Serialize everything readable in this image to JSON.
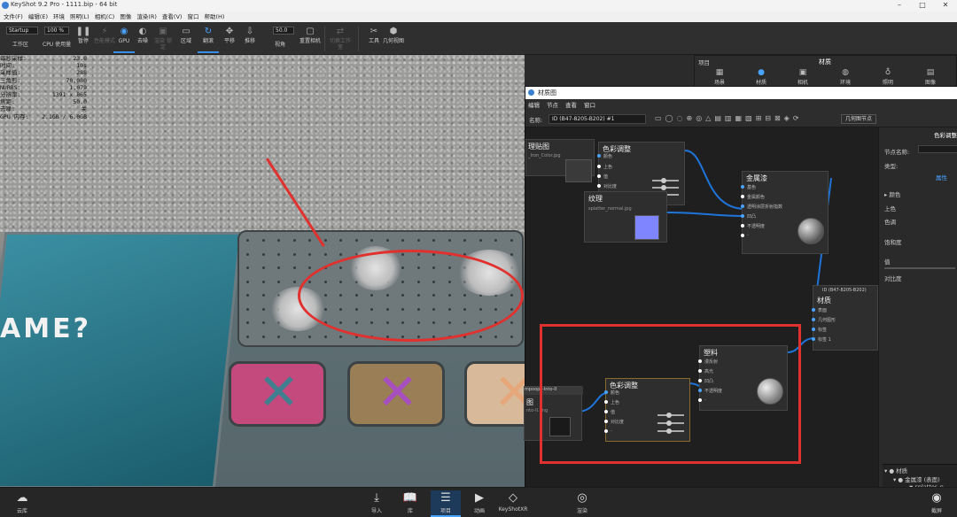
{
  "titlebar": {
    "title": "KeyShot 9.2 Pro  - 1111.bip  - 64 bit",
    "minimize": "–",
    "maximize": "□",
    "close": "✕"
  },
  "menubar": [
    "文件(F)",
    "编辑(E)",
    "环境",
    "照明(L)",
    "相机(C)",
    "图像",
    "渲染(R)",
    "查看(V)",
    "窗口",
    "帮助(H)"
  ],
  "toolbar": {
    "workspace_value": "Startup",
    "workspace_label": "工作区",
    "cpu_value": "100 %",
    "cpu_label": "CPU 使用量",
    "pause_label": "暂停",
    "perf_label": "性能模式",
    "gpu_label": "GPU",
    "denoise_label": "去噪",
    "lock_label": "渲染 锁定",
    "region_label": "区域",
    "tumble_label": "翻滚",
    "pan_label": "平移",
    "dolly_label": "推移",
    "fov_value": "50.0",
    "fov_label": "视角",
    "reset_label": "重置相机",
    "switch_label": "切换工作室",
    "tools_label": "工具",
    "geom_label": "几何视图"
  },
  "stats": [
    {
      "k": "每秒采样:",
      "v": "23.0"
    },
    {
      "k": "时间:",
      "v": "10s"
    },
    {
      "k": "采样值:",
      "v": "288"
    },
    {
      "k": "三角形:",
      "v": "70,080"
    },
    {
      "k": "NURBS:",
      "v": "1,079"
    },
    {
      "k": "分辨率:",
      "v": "1391 x 865"
    },
    {
      "k": "焦距:",
      "v": "50.0"
    },
    {
      "k": "去噪:",
      "v": "关"
    },
    {
      "k": "GPU 内存:",
      "v": "2.1GB / 6.0GB"
    }
  ],
  "scene": {
    "game_text": "AME?"
  },
  "bottombar": {
    "library": "云库",
    "import": "导入",
    "library2": "库",
    "project": "项目",
    "animation": "动画",
    "keyshotxr": "KeyShotXR",
    "render": "渲染",
    "screenshot": "截屏"
  },
  "rightpanel": {
    "header_left": "项目",
    "header_title": "材质",
    "tabs": [
      "场景",
      "材质",
      "相机",
      "环境",
      "照明",
      "图像"
    ]
  },
  "mat_window": {
    "title": "材质图",
    "menu": [
      "编辑",
      "节点",
      "查看",
      "窗口"
    ],
    "name_label": "名称:",
    "name_value": "ID (B47-8205-B202) #1",
    "geo_node_btn": "几何图节点",
    "props_title": "色彩调整",
    "props_node_name": "节点名称:",
    "props_type": "类型:",
    "props_tab": "属性",
    "props_fields": [
      "颜色",
      "上色",
      "色调",
      "饱和度",
      "值",
      "对比度"
    ],
    "tree": {
      "root": "材质",
      "child": "金属漆 (表面)",
      "leaf": "splatter_n"
    }
  },
  "graph": {
    "tex1": {
      "title": "理贴图",
      "file": "_Iron_Color.jpg"
    },
    "cc1": {
      "title": "色彩调整",
      "ports": [
        "颜色",
        "上色",
        "值",
        "对比度",
        "-"
      ]
    },
    "bump": {
      "title": "纹理",
      "file": "splatter_normal.jpg"
    },
    "metal": {
      "title": "金属漆",
      "ports": [
        "基色",
        "金属颜色",
        "透明涂层折射指数",
        "凹凸",
        "不透明度",
        "-"
      ]
    },
    "mat": {
      "title": "材质",
      "id": "ID (B47-8205-B202)",
      "ports": [
        "表面",
        "几何图形",
        "标签",
        "标签 1"
      ]
    },
    "tex2": {
      "title": "图",
      "file_top": "mpoops-Into-II",
      "file": "nto-II.png"
    },
    "cc2": {
      "title": "色彩调整",
      "ports": [
        "颜色",
        "上色",
        "值",
        "对比度",
        "-"
      ]
    },
    "plastic": {
      "title": "塑料",
      "ports": [
        "漫反射",
        "高光",
        "凹凸",
        "不透明度",
        "-"
      ]
    }
  },
  "colors": {
    "accent": "#4aa3ff",
    "annotation": "#e0312e",
    "tile_pink": "#c44a7e",
    "tile_purple": "#9a7e55",
    "tile_peach": "#d8b99a"
  }
}
